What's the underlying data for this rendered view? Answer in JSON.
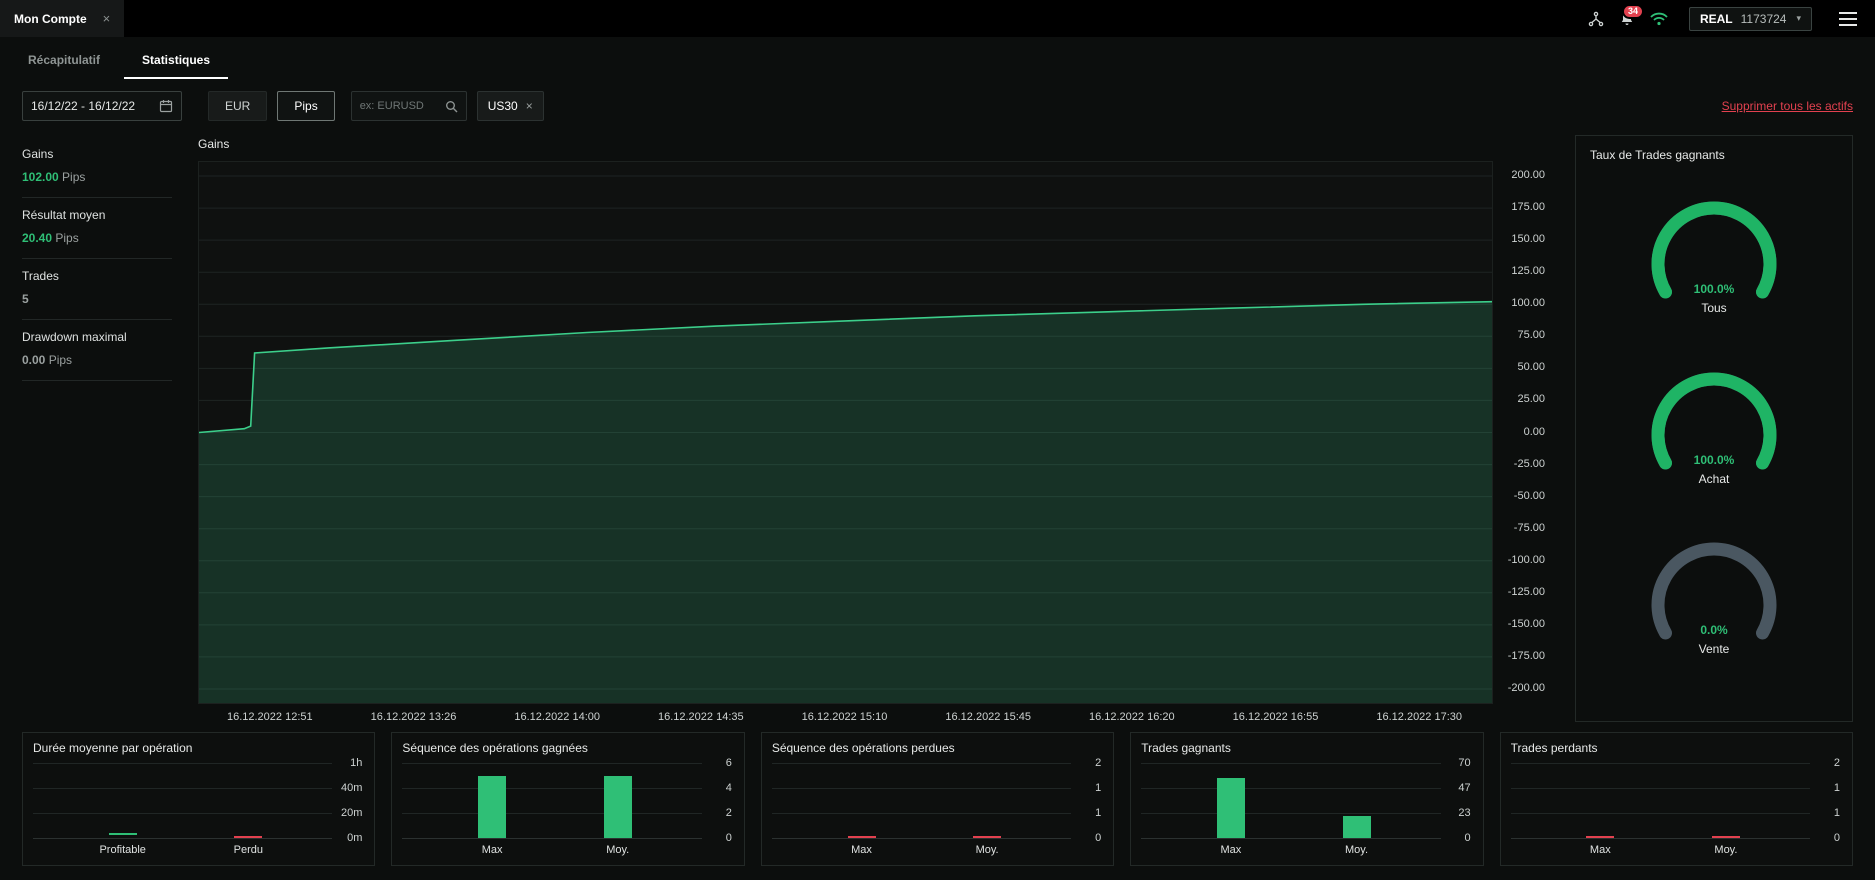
{
  "icons": {
    "close": "×",
    "caret": "▾"
  },
  "topbar": {
    "tab_label": "Mon Compte",
    "notifications_count": "34",
    "account_type": "REAL",
    "account_number": "1173724"
  },
  "tabs": [
    {
      "label": "Récapitulatif"
    },
    {
      "label": "Statistiques"
    }
  ],
  "filters": {
    "date_range": "16/12/22 - 16/12/22",
    "currency_label": "EUR",
    "unit_label": "Pips",
    "search_placeholder": "ex: EURUSD",
    "asset_chip": "US30",
    "remove_all_label": "Supprimer tous les actifs"
  },
  "stats": {
    "items": [
      {
        "label": "Gains",
        "value": "102.00",
        "unit": "Pips",
        "highlight": true
      },
      {
        "label": "Résultat moyen",
        "value": "20.40",
        "unit": "Pips",
        "highlight": true
      },
      {
        "label": "Trades",
        "value": "5",
        "unit": "",
        "highlight": false
      },
      {
        "label": "Drawdown maximal",
        "value": "0.00",
        "unit": "Pips",
        "highlight": false
      }
    ]
  },
  "colors": {
    "green": "#2fbf76",
    "red": "#e2414f",
    "line": "#3ccf8b",
    "fill": "rgba(60,207,139,0.18)",
    "grid": "#1e2423",
    "gauge_green": "#1fb465",
    "gauge_track": "#4a5761"
  },
  "chart_data": [
    {
      "id": "gains_curve",
      "type": "area",
      "title": "Gains",
      "xlabel": "",
      "ylabel": "Pips",
      "ylim": [
        -200,
        200
      ],
      "y_ticks": [
        "200.00",
        "175.00",
        "150.00",
        "125.00",
        "100.00",
        "75.00",
        "50.00",
        "25.00",
        "0.00",
        "-25.00",
        "-50.00",
        "-75.00",
        "-100.00",
        "-125.00",
        "-150.00",
        "-175.00",
        "-200.00"
      ],
      "x_labels": [
        "16.12.2022 12:51",
        "16.12.2022 13:26",
        "16.12.2022 14:00",
        "16.12.2022 14:35",
        "16.12.2022 15:10",
        "16.12.2022 15:45",
        "16.12.2022 16:20",
        "16.12.2022 16:55",
        "16.12.2022 17:30"
      ],
      "points": [
        [
          0,
          0
        ],
        [
          0.035,
          3
        ],
        [
          0.04,
          5
        ],
        [
          0.043,
          62
        ],
        [
          0.1,
          66
        ],
        [
          0.2,
          72
        ],
        [
          0.3,
          78
        ],
        [
          0.4,
          83
        ],
        [
          0.5,
          87
        ],
        [
          0.6,
          91
        ],
        [
          0.7,
          94
        ],
        [
          0.8,
          97
        ],
        [
          0.9,
          100
        ],
        [
          1,
          102
        ]
      ],
      "final_value": 102,
      "grid": true,
      "legend": "none"
    },
    {
      "id": "win_rate",
      "type": "gauge",
      "title": "Taux de Trades gagnants",
      "items": [
        {
          "label": "Tous",
          "value": "100.0%",
          "pct": 100
        },
        {
          "label": "Achat",
          "value": "100.0%",
          "pct": 100
        },
        {
          "label": "Vente",
          "value": "0.0%",
          "pct": 0
        }
      ]
    },
    {
      "id": "avg_duration",
      "type": "bar",
      "title": "Durée moyenne par opération",
      "categories": [
        "Profitable",
        "Perdu"
      ],
      "values": [
        3,
        0
      ],
      "ymax": 60,
      "y_ticks": [
        "1h",
        "40m",
        "20m",
        "0m"
      ],
      "bar_colors": [
        "green",
        "red"
      ],
      "bar_style": "dash"
    },
    {
      "id": "win_streak",
      "type": "bar",
      "title": "Séquence des opérations gagnées",
      "categories": [
        "Max",
        "Moy."
      ],
      "values": [
        5,
        5
      ],
      "ymax": 6,
      "y_ticks": [
        "6",
        "4",
        "2",
        "0"
      ],
      "bar_colors": [
        "green",
        "green"
      ],
      "bar_style": "bar"
    },
    {
      "id": "loss_streak",
      "type": "bar",
      "title": "Séquence des opérations perdues",
      "categories": [
        "Max",
        "Moy."
      ],
      "values": [
        0,
        0
      ],
      "ymax": 2,
      "y_ticks": [
        "2",
        "1",
        "1",
        "0"
      ],
      "bar_colors": [
        "red",
        "red"
      ],
      "bar_style": "dash"
    },
    {
      "id": "winning_trades",
      "type": "bar",
      "title": "Trades gagnants",
      "categories": [
        "Max",
        "Moy."
      ],
      "values": [
        56,
        20.4
      ],
      "ymax": 70,
      "y_ticks": [
        "70",
        "47",
        "23",
        "0"
      ],
      "bar_colors": [
        "green",
        "green"
      ],
      "bar_style": "bar"
    },
    {
      "id": "losing_trades",
      "type": "bar",
      "title": "Trades perdants",
      "categories": [
        "Max",
        "Moy."
      ],
      "values": [
        0,
        0
      ],
      "ymax": 2,
      "y_ticks": [
        "2",
        "1",
        "1",
        "0"
      ],
      "bar_colors": [
        "red",
        "red"
      ],
      "bar_style": "dash"
    }
  ]
}
